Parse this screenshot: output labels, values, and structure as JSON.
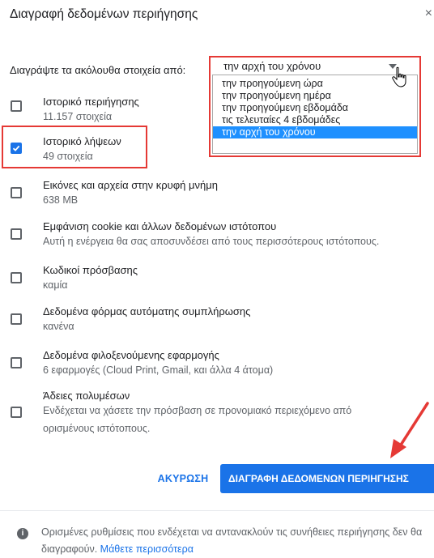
{
  "dialog": {
    "title": "Διαγραφή δεδομένων περιήγησης",
    "close_label": "×",
    "range_label": "Διαγράψτε τα ακόλουθα στοιχεία από:",
    "range_selected": "την αρχή του χρόνου",
    "range_options": [
      "την προηγούμενη ώρα",
      "την προηγούμενη ημέρα",
      "την προηγούμενη εβδομάδα",
      "τις τελευταίες 4 εβδομάδες",
      "την αρχή του χρόνου"
    ]
  },
  "items": [
    {
      "title": "Ιστορικό περιήγησης",
      "sub": "11.157 στοιχεία",
      "checked": false
    },
    {
      "title": "Ιστορικό λήψεων",
      "sub": "49 στοιχεία",
      "checked": true
    },
    {
      "title": "Εικόνες και αρχεία στην κρυφή μνήμη",
      "sub": "638 MB",
      "checked": false
    },
    {
      "title": "Εμφάνιση cookie και άλλων δεδομένων ιστότοπου",
      "sub": "Αυτή η ενέργεια θα σας αποσυνδέσει από τους περισσότερους ιστότοπους.",
      "checked": false
    },
    {
      "title": "Κωδικοί πρόσβασης",
      "sub": "καμία",
      "checked": false
    },
    {
      "title": "Δεδομένα φόρμας αυτόματης συμπλήρωσης",
      "sub": "κανένα",
      "checked": false
    },
    {
      "title": "Δεδομένα φιλοξενούμενης εφαρμογής",
      "sub": "6 εφαρμογές (Cloud Print, Gmail, και άλλα 4 άτομα)",
      "checked": false
    },
    {
      "title": "Άδειες πολυμέσων",
      "sub_line1": "Ενδέχεται να χάσετε την πρόσβαση σε προνομιακό περιεχόμενο από",
      "sub_line2": "ορισμένους ιστότοπους.",
      "checked": false
    }
  ],
  "buttons": {
    "cancel": "ΑΚΥΡΩΣΗ",
    "clear": "ΔΙΑΓΡΑΦΗ ΔΕΔΟΜΕΝΩΝ ΠΕΡΙΗΓΗΣΗΣ"
  },
  "footer": {
    "text": "Ορισμένες ρυθμίσεις που ενδέχεται να αντανακλούν τις συνήθειες περιήγησης δεν θα διαγραφούν.",
    "link": "Μάθετε περισσότερα"
  },
  "colors": {
    "accent": "#1a73e8",
    "highlight_red": "#e53935",
    "menu_selected": "#1e90ff"
  }
}
